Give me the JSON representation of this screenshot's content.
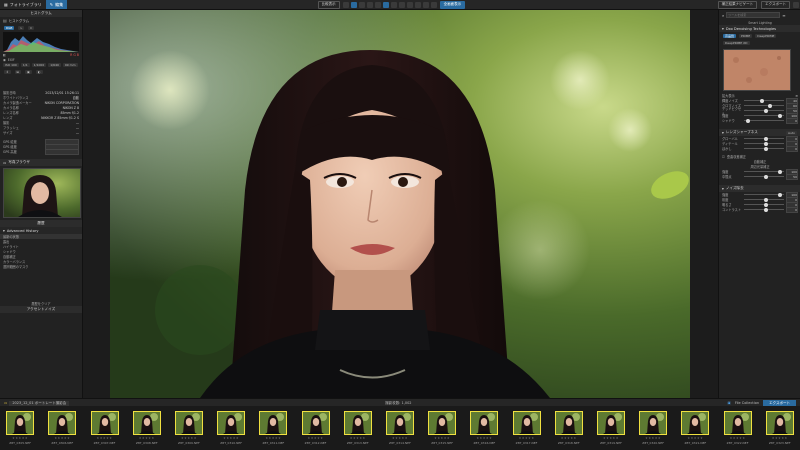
{
  "top": {
    "tab_library": "フォトライブラリ",
    "tab_edit": "編集",
    "btn_mid_1": "比較表示",
    "btn_mid_2": "全画面表示",
    "btn_right_1": "補正結果ナビゲート",
    "btn_right_2": "エクスポート"
  },
  "left": {
    "histogram_header": "ヒストグラム",
    "histogram_label": "ヒストグラム",
    "chip_rgb": "RGB",
    "rgb_readout": "R G B",
    "exif_label": "EXIF",
    "exif_buttons": [
      "ISO 100",
      "1/1",
      "1/1000",
      "1/640",
      "99 mm"
    ],
    "info_rows": [
      {
        "k": "撮影日時",
        "v": "2023/12/01 15:26:11"
      },
      {
        "k": "ホワイトバランス",
        "v": "自動"
      },
      {
        "k": "カメラ製造メーカー",
        "v": "NIKON CORPORATION"
      },
      {
        "k": "カメラ名称",
        "v": "NIKON Z 8"
      },
      {
        "k": "レンズ名称",
        "v": "85mm f/1.2"
      },
      {
        "k": "レンズ",
        "v": "NIKKOR Z 85mm f/1.2 S"
      },
      {
        "k": "撮影",
        "v": "—"
      },
      {
        "k": "フラッシュ",
        "v": "—"
      },
      {
        "k": "サイズ",
        "v": "—"
      }
    ],
    "gps_rows": [
      "GPS 緯度",
      "GPS 経度",
      "GPS 高度"
    ],
    "preview_header": "写真ブラウザ",
    "history_header": "履歴",
    "history_section": "Advanced History",
    "history_items": [
      "最新の状態",
      "露出",
      "ハイライト",
      "シャドウ",
      "自動補正",
      "カラーバランス",
      "選択範囲のマスク"
    ],
    "history_clear": "履歴をクリア",
    "bottom_header": "アクセントノイズ"
  },
  "right": {
    "search_placeholder": "ツールを検索",
    "smart_lighting": "Smart Lighting",
    "panel_title": "Dxo Denoising Technologies",
    "mode_standard": "高品質",
    "mode_hq": "DeepPRIME",
    "mode_xd": "DeepPRIME XD",
    "mode_alt": "PRIME",
    "preview_label": "拡大表示",
    "sliders_1": [
      {
        "label": "輝度ノイズ",
        "val": "40"
      },
      {
        "label": "クロマノイズ",
        "val": "60"
      },
      {
        "label": "デッドピクセル",
        "val": "50"
      },
      {
        "label": "強度",
        "val": "100"
      },
      {
        "label": "シャドウ",
        "val": "0"
      }
    ],
    "section_2": "レンズシャープネス",
    "section_2_auto": "Auto",
    "sliders_2": [
      {
        "label": "グローバル",
        "val": "0"
      },
      {
        "label": "ディテール",
        "val": "0"
      },
      {
        "label": "ぼかし",
        "val": "0"
      }
    ],
    "section_3": "歪曲収差補正",
    "section_3a": "自動補正",
    "section_3b": "周辺光量補正",
    "sliders_3": [
      {
        "label": "強度",
        "val": "100"
      },
      {
        "label": "中間点",
        "val": "50"
      }
    ],
    "section_4": "ノイズ除去",
    "sliders_4": [
      {
        "label": "強度",
        "val": "100"
      },
      {
        "label": "彩度",
        "val": "0"
      },
      {
        "label": "明るさ",
        "val": "0"
      },
      {
        "label": "コントラスト",
        "val": "0"
      }
    ]
  },
  "filmbar": {
    "path": "2023_12_01 ポートレート撮影会",
    "count": "撮影枚数: 1,002",
    "collection": "File Collection",
    "export": "エクスポート"
  },
  "thumbs": [
    "Z8T_0305.NEF",
    "Z8T_0306.NEF",
    "Z8T_0307.NEF",
    "Z8T_0308.NEF",
    "Z8T_0309.NEF",
    "Z8T_0310.NEF",
    "Z8T_0311.NEF",
    "Z8T_0312.NEF",
    "Z8T_0313.NEF",
    "Z8T_0314.NEF",
    "Z8T_0315.NEF",
    "Z8T_0316.NEF",
    "Z8T_0317.NEF",
    "Z8T_0318.NEF",
    "Z8T_0319.NEF",
    "Z8T_0320.NEF",
    "Z8T_0321.NEF",
    "Z8T_0322.NEF",
    "Z8T_0323.NEF"
  ]
}
